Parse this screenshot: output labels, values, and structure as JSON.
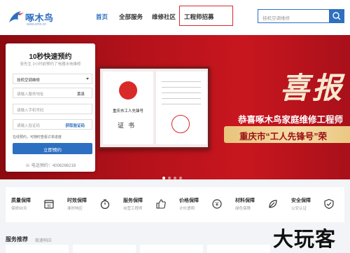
{
  "header": {
    "logo_text": "啄木鸟",
    "logo_url": "www.zmn.cn",
    "nav": [
      "首页",
      "全部服务",
      "维修社区",
      "工程师招募"
    ],
    "active_nav": "首页",
    "search_placeholder": "挂机空调维修"
  },
  "form": {
    "title": "10秒快速预约",
    "subtitle": "张先生 3小时前预约了电器水电维修",
    "service_select": "挂机空调维修",
    "address_placeholder": "请输入服务地址",
    "city": "黄县",
    "phone_placeholder": "请输入手机号码",
    "code_placeholder": "请输入验证码",
    "code_button": "获取验证码",
    "note": "在线预约，可随时查看订单进度",
    "submit": "立即预约",
    "hotline": "电话预约：4006266218"
  },
  "banner": {
    "headline_char": "喜报",
    "line1": "恭喜啄木鸟家庭维修工程师",
    "line2": "重庆市“工人先锋号”荣",
    "cert_title": "重庆市工人先锋号",
    "cert_label": "证书",
    "slide_count": 4,
    "active_slide": 0
  },
  "features": [
    {
      "title": "质量保障",
      "sub": "保修90天",
      "icon": "calendar-icon"
    },
    {
      "title": "时效保障",
      "sub": "准时响应",
      "icon": "stopwatch-icon"
    },
    {
      "title": "服务保障",
      "sub": "自营工程师",
      "icon": "thumbsup-icon"
    },
    {
      "title": "价格保障",
      "sub": "计价透明",
      "icon": "yen-icon"
    },
    {
      "title": "材料保障",
      "sub": "绿色保障",
      "icon": "leaf-icon"
    },
    {
      "title": "安全保障",
      "sub": "公安认证",
      "icon": "shield-icon"
    }
  ],
  "section": {
    "title": "服务推荐",
    "sub": "极速响应"
  },
  "watermark": "大玩客",
  "colors": {
    "primary": "#2d6fc0",
    "banner_red": "#b5121b",
    "highlight_border": "#d9292b"
  }
}
